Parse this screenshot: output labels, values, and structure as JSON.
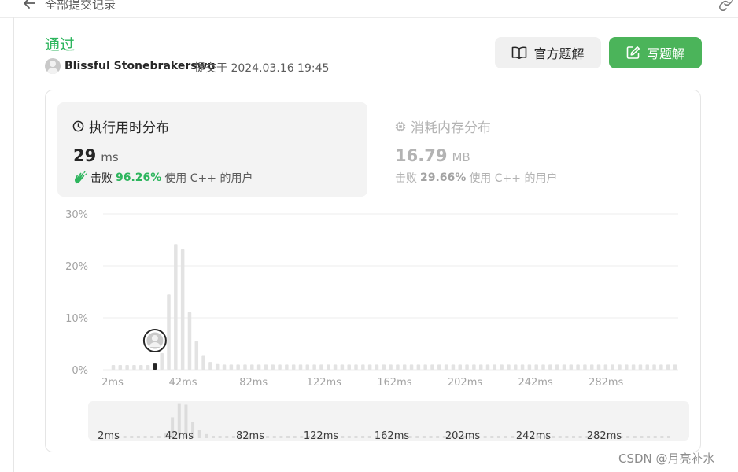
{
  "breadcrumb": {
    "label": "全部提交记录"
  },
  "submission": {
    "status": "通过",
    "user": "Blissful Stonebrakerswu",
    "submitted_at": "提交于 2024.03.16 19:45"
  },
  "buttons": {
    "official_solution": "官方题解",
    "write_solution": "写题解"
  },
  "runtime": {
    "title": "执行用时分布",
    "value": "29",
    "unit": "ms",
    "beats_prefix": "击败",
    "beats_pct": "96.26%",
    "beats_suffix": "使用 C++ 的用户"
  },
  "memory": {
    "title": "消耗内存分布",
    "value": "16.79",
    "unit": "MB",
    "beats_prefix": "击败",
    "beats_pct": "29.66%",
    "beats_suffix": "使用 C++ 的用户"
  },
  "colors": {
    "accent_green": "#2db55d",
    "button_green": "#4bb45a",
    "bar": "#e3e3e3",
    "highlight_bar": "#262626"
  },
  "chart_data": {
    "type": "bar",
    "y_ticks": [
      "30%",
      "20%",
      "10%",
      "0%"
    ],
    "ylim": [
      0,
      30
    ],
    "x_ticks": [
      "2ms",
      "42ms",
      "82ms",
      "122ms",
      "162ms",
      "202ms",
      "242ms",
      "282ms"
    ],
    "grid": true,
    "bin_ms": 5,
    "series": [
      {
        "values": [
          0.9,
          0.9,
          0.9,
          0.9,
          0.9,
          0.9,
          1.2,
          3.2,
          14.5,
          24.2,
          23.2,
          11.1,
          5.5,
          2.8,
          1.5,
          1.1,
          1,
          1,
          1,
          1,
          1,
          1,
          1,
          1,
          1,
          1,
          1,
          1,
          1,
          1,
          1,
          1,
          1,
          1,
          1,
          1,
          1,
          1,
          1,
          1,
          1,
          1,
          1,
          1,
          1,
          1,
          1,
          1,
          1,
          1,
          1,
          1,
          1,
          1,
          1,
          1,
          1,
          1,
          1,
          1,
          1,
          1,
          1,
          1,
          1,
          1,
          1,
          1,
          1,
          1,
          1,
          1,
          1,
          1,
          1,
          1,
          1,
          1,
          1,
          1,
          1,
          1
        ]
      }
    ],
    "highlight_index": 6,
    "highlight_value": 1.2,
    "overview_x_ticks": [
      "2ms",
      "42ms",
      "82ms",
      "122ms",
      "162ms",
      "202ms",
      "242ms",
      "282ms"
    ]
  },
  "watermark": "CSDN @月亮补水"
}
